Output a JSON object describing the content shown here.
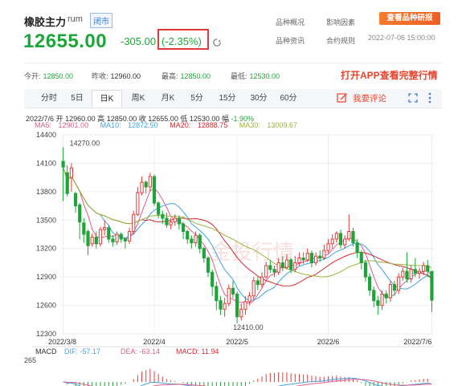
{
  "header": {
    "title": "橡胶主力",
    "code": "rum",
    "status": "闭市",
    "price": "12655.00",
    "change": "-305.00",
    "change_pct": "(-2.35%)",
    "links": [
      "品种概况",
      "影响因素",
      "品种资讯",
      "合约规则"
    ],
    "research_button": "查看品种研报",
    "datetime": "2022-07-06 15:00:00"
  },
  "stats": [
    {
      "label": "今开:",
      "value": "12850.00"
    },
    {
      "label": "昨收:",
      "value": "12960.00"
    },
    {
      "label": "最高:",
      "value": "12850.00"
    },
    {
      "label": "最低:",
      "value": "12530.00"
    }
  ],
  "app_promo": "打开APP查看完整行情",
  "tabs": [
    "分时",
    "5日",
    "日K",
    "周K",
    "月K",
    "5分",
    "15分",
    "30分",
    "60分"
  ],
  "active_tab": "日K",
  "comment_button": "我要评论",
  "info_line": {
    "date": "2022/7/6",
    "open_label": "开",
    "open": "12960.00",
    "high_label": "高",
    "high": "12850.00",
    "close_label": "收",
    "close": "12655.00",
    "low_label": "低",
    "low": "12530.00",
    "amp_label": "幅",
    "amp": "-1.90%"
  },
  "ma": [
    {
      "label": "MA5:",
      "value": "12901.00",
      "color": "#e55a8c"
    },
    {
      "label": "MA10:",
      "value": "12872.50",
      "color": "#3fa2e0"
    },
    {
      "label": "MA20:",
      "value": "12888.75",
      "color": "#d9262c"
    },
    {
      "label": "MA30:",
      "value": "13009.67",
      "color": "#9bb43a"
    }
  ],
  "macd": {
    "name": "MACD",
    "dif_label": "DIF:",
    "dif": "-57.17",
    "dea_label": "DEA:",
    "dea": "-63.14",
    "macd_label": "MACD:",
    "macd_value": "11.94",
    "axis_top": "265"
  },
  "watermark": "金投行情",
  "chart_data": {
    "type": "candlestick",
    "ylim": [
      12300,
      14400
    ],
    "y_ticks": [
      "14400",
      "14100",
      "13800",
      "13500",
      "13200",
      "12900",
      "12600",
      "12300"
    ],
    "x_ticks": [
      "2022/3/8",
      "2022/4",
      "2022/5",
      "2022/6",
      "2022/7/6"
    ],
    "annotations": [
      {
        "text": "14270.00",
        "value": 14270
      },
      {
        "text": "12410.00",
        "value": 12410
      }
    ],
    "candles": [
      [
        14120,
        14060,
        14270,
        13700
      ],
      [
        14000,
        13780,
        14080,
        13750
      ],
      [
        13950,
        14050,
        14100,
        13800
      ],
      [
        13780,
        13650,
        13800,
        13580
      ],
      [
        13660,
        13480,
        13680,
        13300
      ],
      [
        13470,
        13350,
        13520,
        13260
      ],
      [
        13380,
        13230,
        13400,
        13130
      ],
      [
        13250,
        13320,
        13360,
        13220
      ],
      [
        13320,
        13250,
        13380,
        13200
      ],
      [
        13250,
        13400,
        13430,
        13220
      ],
      [
        13400,
        13420,
        13500,
        13340
      ],
      [
        13420,
        13300,
        13450,
        13260
      ],
      [
        13300,
        13270,
        13340,
        13220
      ],
      [
        13270,
        13350,
        13380,
        13240
      ],
      [
        13350,
        13300,
        13370,
        13260
      ],
      [
        13300,
        13280,
        13320,
        13200
      ],
      [
        13280,
        13380,
        13420,
        13250
      ],
      [
        13380,
        13560,
        13600,
        13350
      ],
      [
        13560,
        13790,
        13850,
        13540
      ],
      [
        13790,
        13900,
        13960,
        13760
      ],
      [
        13900,
        13850,
        13920,
        13780
      ],
      [
        13850,
        13960,
        14000,
        13800
      ],
      [
        13960,
        13680,
        13980,
        13650
      ],
      [
        13680,
        13560,
        13700,
        13520
      ],
      [
        13560,
        13520,
        13600,
        13460
      ],
      [
        13520,
        13450,
        13580,
        13420
      ],
      [
        13450,
        13480,
        13520,
        13400
      ],
      [
        13480,
        13520,
        13560,
        13440
      ],
      [
        13520,
        13460,
        13550,
        13400
      ],
      [
        13460,
        13380,
        13480,
        13300
      ],
      [
        13380,
        13300,
        13400,
        13250
      ],
      [
        13300,
        13260,
        13340,
        13200
      ],
      [
        13260,
        13340,
        13380,
        13220
      ],
      [
        13340,
        13200,
        13360,
        13150
      ],
      [
        13200,
        13100,
        13220,
        13050
      ],
      [
        13100,
        12950,
        13120,
        12900
      ],
      [
        12950,
        12800,
        12980,
        12700
      ],
      [
        12800,
        12650,
        12850,
        12550
      ],
      [
        12650,
        12560,
        12700,
        12500
      ],
      [
        12560,
        12620,
        12680,
        12480
      ],
      [
        12620,
        12780,
        12820,
        12590
      ],
      [
        12780,
        12720,
        12860,
        12680
      ],
      [
        12720,
        12480,
        12750,
        12410
      ],
      [
        12480,
        12560,
        12620,
        12440
      ],
      [
        12560,
        12640,
        12700,
        12500
      ],
      [
        12640,
        12700,
        12740,
        12600
      ],
      [
        12700,
        12860,
        12900,
        12660
      ],
      [
        12860,
        12820,
        12900,
        12760
      ],
      [
        12820,
        12900,
        12950,
        12780
      ],
      [
        12900,
        13020,
        13060,
        12880
      ],
      [
        13020,
        12980,
        13080,
        12940
      ],
      [
        12980,
        12950,
        13020,
        12900
      ],
      [
        12950,
        13050,
        13100,
        12920
      ],
      [
        13050,
        13000,
        13120,
        12960
      ],
      [
        13000,
        13080,
        13140,
        12980
      ],
      [
        13080,
        12980,
        13100,
        12940
      ],
      [
        12980,
        13050,
        13120,
        12950
      ],
      [
        13050,
        13100,
        13160,
        13020
      ],
      [
        13100,
        13080,
        13160,
        13040
      ],
      [
        13080,
        13150,
        13200,
        13060
      ],
      [
        13150,
        13050,
        13180,
        13000
      ],
      [
        13050,
        13120,
        13160,
        13020
      ],
      [
        13120,
        13100,
        13180,
        13060
      ],
      [
        13100,
        13180,
        13240,
        13080
      ],
      [
        13180,
        13250,
        13300,
        13150
      ],
      [
        13250,
        13300,
        13350,
        13200
      ],
      [
        13300,
        13360,
        13380,
        13260
      ],
      [
        13360,
        13240,
        13400,
        13200
      ],
      [
        13240,
        13300,
        13340,
        13200
      ],
      [
        13300,
        13380,
        13560,
        13280
      ],
      [
        13380,
        13260,
        13420,
        13220
      ],
      [
        13260,
        13160,
        13300,
        13100
      ],
      [
        13160,
        13050,
        13180,
        12980
      ],
      [
        13050,
        12900,
        13080,
        12850
      ],
      [
        12900,
        12760,
        12940,
        12700
      ],
      [
        12760,
        12650,
        12800,
        12580
      ],
      [
        12650,
        12600,
        12700,
        12500
      ],
      [
        12600,
        12720,
        12760,
        12550
      ],
      [
        12720,
        12680,
        12760,
        12620
      ],
      [
        12680,
        12820,
        12860,
        12640
      ],
      [
        12820,
        12760,
        12860,
        12700
      ],
      [
        12760,
        12900,
        12940,
        12720
      ],
      [
        12900,
        12960,
        13000,
        12860
      ],
      [
        12960,
        12880,
        13160,
        12840
      ],
      [
        12880,
        12980,
        13020,
        12840
      ],
      [
        12980,
        12940,
        13100,
        12900
      ],
      [
        12940,
        12960,
        13000,
        12880
      ],
      [
        12960,
        13020,
        13060,
        12920
      ],
      [
        13020,
        12960,
        13080,
        12900
      ],
      [
        12960,
        12655,
        12850,
        12530
      ]
    ]
  }
}
